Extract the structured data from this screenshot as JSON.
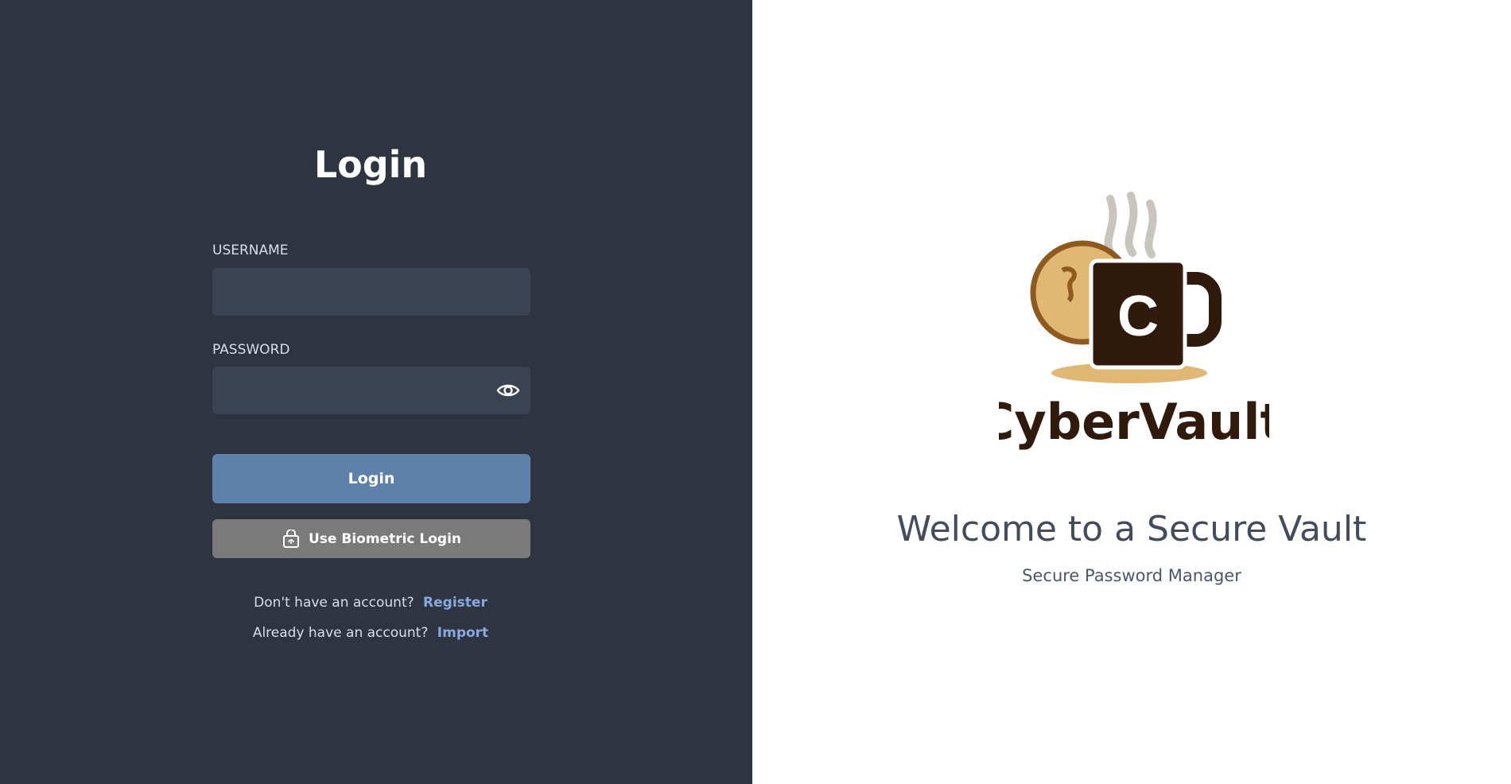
{
  "login": {
    "title": "Login",
    "username_label": "USERNAME",
    "username_value": "",
    "password_label": "PASSWORD",
    "password_value": "",
    "login_button": "Login",
    "biometric_button": "Use Biometric Login",
    "register_prompt": "Don't have an account?",
    "register_link": "Register",
    "import_prompt": "Already have an account?",
    "import_link": "Import"
  },
  "brand": {
    "name": "CyberVault",
    "logo_letter": "C",
    "welcome": "Welcome to a Secure Vault",
    "tagline": "Secure Password Manager"
  },
  "colors": {
    "left_bg": "#2e3440",
    "field_bg": "#3b4252",
    "login_button": "#5e81ac",
    "biometric_button": "#7a7a7a",
    "link": "#88a8e0",
    "brand_dark": "#2f1a0c",
    "brand_tan": "#e0b873"
  },
  "icons": {
    "password_toggle": "eye-icon",
    "biometric": "fingerprint-lock-icon"
  }
}
